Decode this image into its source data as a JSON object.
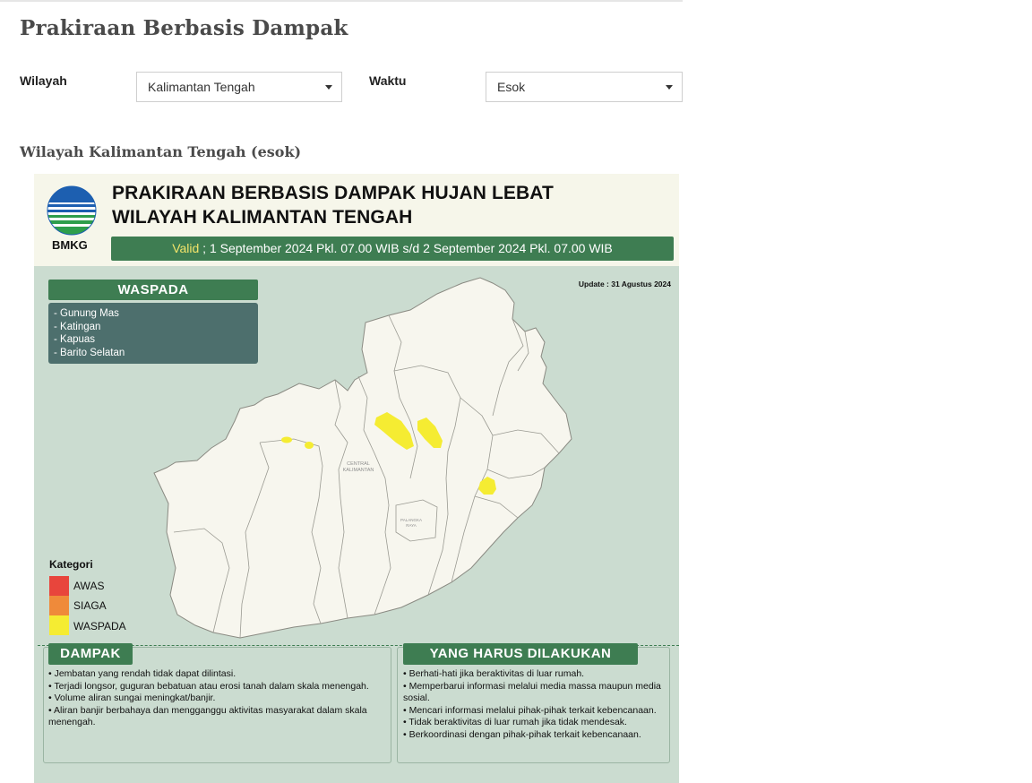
{
  "page": {
    "title": "Prakiraan Berbasis Dampak",
    "section_title": "Wilayah Kalimantan Tengah (esok)"
  },
  "filters": {
    "region_label": "Wilayah",
    "region_value": "Kalimantan Tengah",
    "time_label": "Waktu",
    "time_value": "Esok"
  },
  "infographic": {
    "logo_text": "BMKG",
    "title_line1": "PRAKIRAAN BERBASIS DAMPAK HUJAN LEBAT",
    "title_line2": "WILAYAH KALIMANTAN TENGAH",
    "valid_word": "Valid",
    "valid_rest": " ; 1 September 2024 Pkl. 07.00 WIB s/d 2 September 2024 Pkl. 07.00 WIB",
    "update": "Update : 31 Agustus 2024",
    "waspada_title": "WASPADA",
    "waspada_items": [
      "- Gunung Mas",
      "- Katingan",
      "- Kapuas",
      "- Barito Selatan"
    ],
    "map_labels": {
      "province_line1": "CENTRAL",
      "province_line2": "KALIMANTAN",
      "city_line1": "PALANGKA",
      "city_line2": "RAYA"
    },
    "legend": {
      "title": "Kategori",
      "items": [
        {
          "label": "AWAS",
          "color": "#e8453c"
        },
        {
          "label": "SIAGA",
          "color": "#ef8a3a"
        },
        {
          "label": "WASPADA",
          "color": "#f5ec32"
        }
      ]
    },
    "dampak": {
      "title": "DAMPAK",
      "items": [
        "• Jembatan yang rendah tidak dapat dilintasi.",
        "• Terjadi longsor, guguran bebatuan atau erosi tanah dalam skala menengah.",
        "• Volume aliran sungai meningkat/banjir.",
        "• Aliran banjir berbahaya dan mengganggu aktivitas masyarakat dalam skala menengah."
      ]
    },
    "harus": {
      "title": "YANG HARUS DILAKUKAN",
      "items": [
        "• Berhati-hati jika beraktivitas di luar rumah.",
        "• Memperbarui informasi melalui media massa maupun media sosial.",
        "• Mencari informasi melalui pihak-pihak terkait kebencanaan.",
        "• Tidak beraktivitas di luar rumah jika tidak mendesak.",
        "• Berkoordinasi dengan pihak-pihak terkait kebencanaan."
      ]
    },
    "colors": {
      "header_green": "#3e7d52",
      "map_bg": "#cbdcd0",
      "land": "#f7f6ee",
      "waspada_fill": "#f5ec32"
    }
  }
}
